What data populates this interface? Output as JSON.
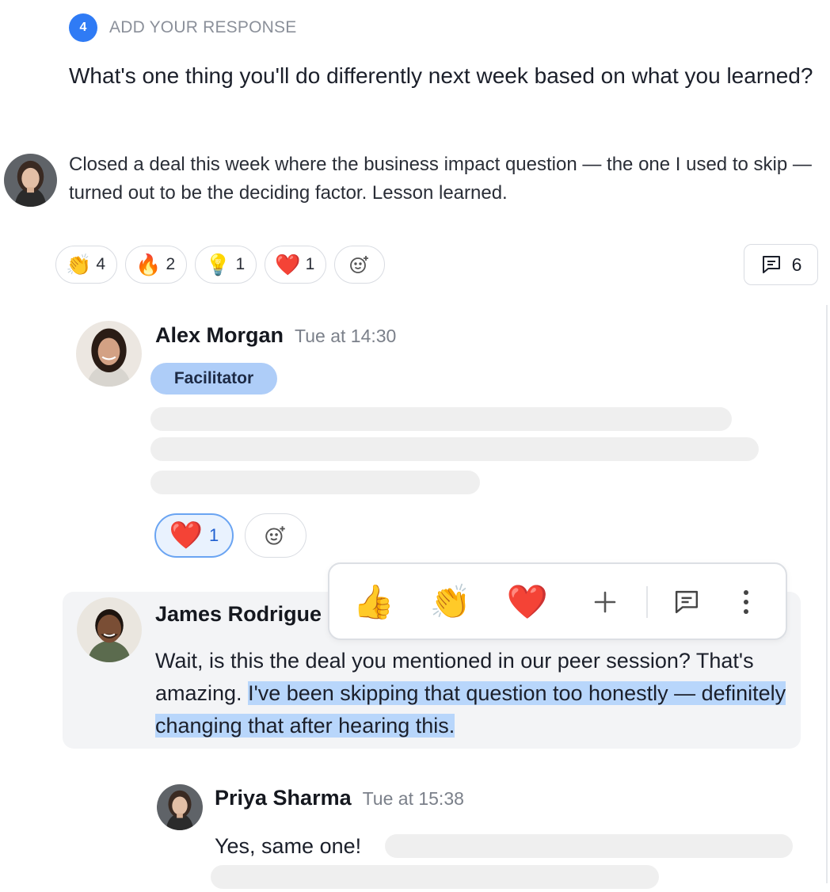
{
  "step": {
    "number": "4",
    "label": "ADD YOUR RESPONSE"
  },
  "question": "What's one thing you'll do differently next week based on what you learned?",
  "response": {
    "text": "Closed a deal this week where the business impact question — the one I used to skip — turned out to be the deciding factor. Lesson learned.",
    "reactions": [
      {
        "emoji": "👏",
        "count": "4",
        "icon": "clap-emoji-icon"
      },
      {
        "emoji": "🔥",
        "count": "2",
        "icon": "fire-emoji-icon"
      },
      {
        "emoji": "💡",
        "count": "1",
        "icon": "lightbulb-emoji-icon"
      },
      {
        "emoji": "❤️",
        "count": "1",
        "icon": "heart-emoji-icon"
      }
    ],
    "comment_count": "6"
  },
  "comments": {
    "alex": {
      "name": "Alex Morgan",
      "time": "Tue at 14:30",
      "role": "Facilitator",
      "reaction": {
        "emoji": "❤️",
        "count": "1"
      }
    },
    "james": {
      "name": "James Rodrigue",
      "text_plain": "Wait, is this the deal you mentioned in our peer session? That's amazing. ",
      "text_highlight": "I've been skipping that question too honestly — definitely changing that after hearing this."
    },
    "priya": {
      "name": "Priya Sharma",
      "time": "Tue at 15:38",
      "text": "Yes, same one!"
    }
  },
  "toolbar": {
    "quick_reactions": [
      {
        "emoji": "👍",
        "icon": "thumbs-up-emoji-icon"
      },
      {
        "emoji": "👏",
        "icon": "clap-emoji-icon"
      },
      {
        "emoji": "❤️",
        "icon": "heart-emoji-icon"
      }
    ],
    "add": "+"
  },
  "colors": {
    "accent": "#2f7bf5",
    "role_badge": "#aecdf8",
    "highlight": "#b8d6fb",
    "active_reaction_border": "#6aa4f2"
  }
}
